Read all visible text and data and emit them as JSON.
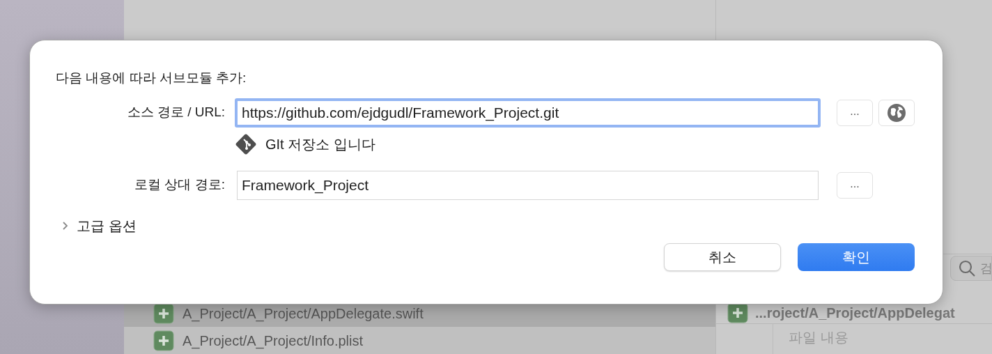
{
  "background": {
    "file_rows": [
      {
        "name": "A_Project/A_Project/AppDelegate.swift",
        "selected": true
      },
      {
        "name": "A_Project/A_Project/Info.plist",
        "selected": false
      }
    ],
    "search": {
      "placeholder": "검"
    },
    "detail": {
      "file_title": "...roject/A_Project/AppDelegat",
      "section": "파일 내용"
    }
  },
  "dialog": {
    "title": "다음 내용에 따라 서브모듈 추가:",
    "source": {
      "label": "소스 경로 / URL:",
      "value": "https://github.com/ejdgudl/Framework_Project.git",
      "focused": true,
      "browse_button": "..."
    },
    "git_status": "GIt 저장소 입니다",
    "local": {
      "label": "로컬 상대 경로:",
      "value": "Framework_Project",
      "focused": false,
      "browse_button": "..."
    },
    "advanced": {
      "label": "고급 옵션",
      "expanded": false
    },
    "buttons": [
      {
        "label": "취소",
        "kind": "secondary"
      },
      {
        "label": "확인",
        "kind": "primary"
      }
    ]
  }
}
